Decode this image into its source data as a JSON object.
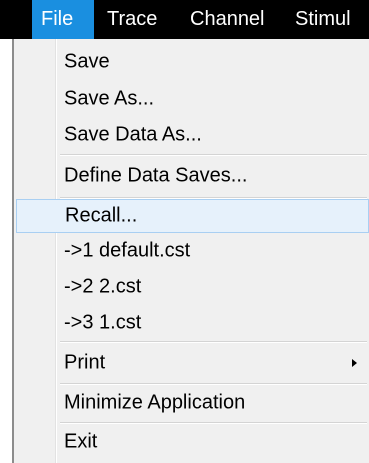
{
  "menubar": {
    "items": [
      {
        "label": "File"
      },
      {
        "label": "Trace"
      },
      {
        "label": "Channel"
      },
      {
        "label": "Stimul"
      }
    ]
  },
  "file_menu": {
    "items": [
      {
        "label": "Save"
      },
      {
        "label": "Save As..."
      },
      {
        "label": "Save Data As..."
      },
      {
        "label": "Define Data Saves..."
      },
      {
        "label": "Recall..."
      },
      {
        "label": "->1 default.cst"
      },
      {
        "label": "->2 2.cst"
      },
      {
        "label": "->3 1.cst"
      },
      {
        "label": "Print",
        "submenu": true
      },
      {
        "label": "Minimize Application"
      },
      {
        "label": "Exit"
      }
    ]
  },
  "colors": {
    "menubar_bg": "#000000",
    "active_menu_bg": "#1a8fe0",
    "dropdown_bg": "#f0f0f0",
    "hover_bg": "#e6f1fb",
    "hover_border": "#a9cff2"
  }
}
